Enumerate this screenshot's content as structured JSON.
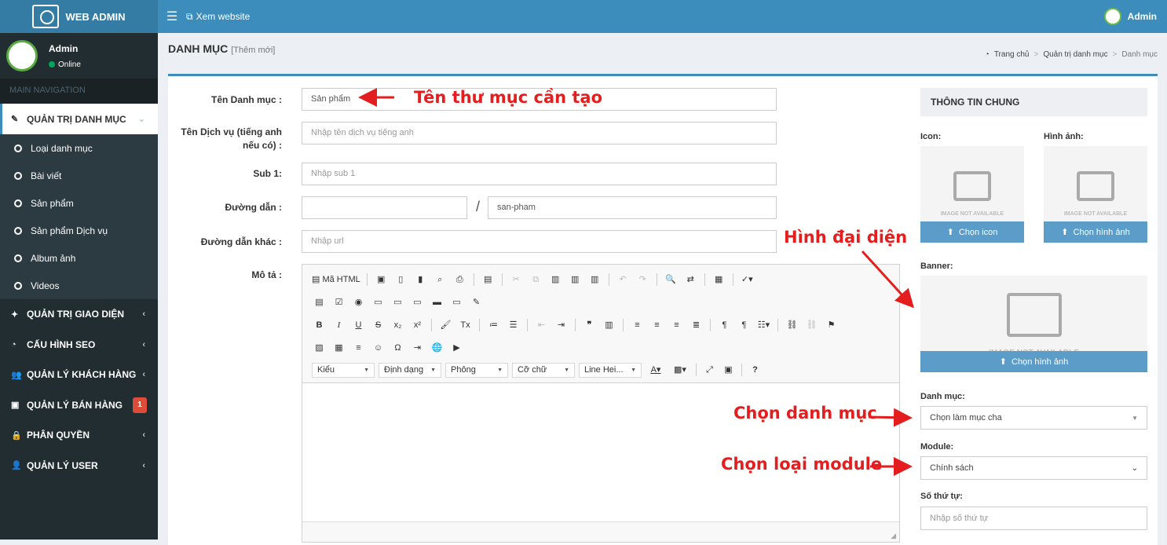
{
  "app": {
    "title": "WEB ADMIN"
  },
  "topbar": {
    "menu_icon": "hamburger-icon",
    "site_label": "Xem website",
    "user": "Admin"
  },
  "user_panel": {
    "name": "Admin",
    "status": "Online"
  },
  "nav": {
    "header": "MAIN NAVIGATION",
    "active": {
      "label": "QUẢN TRỊ DANH MỤC",
      "submenu": [
        "Loại danh mục",
        "Bài viết",
        "Sản phẩm",
        "Sản phẩm Dịch vụ",
        "Album ảnh",
        "Videos"
      ]
    },
    "items": [
      {
        "label": "QUẢN TRỊ GIAO DIỆN",
        "icon": "wand-icon"
      },
      {
        "label": "CẤU HÌNH SEO",
        "icon": "dashboard-icon"
      },
      {
        "label": "QUẢN LÝ KHÁCH HÀNG",
        "icon": "users-icon"
      },
      {
        "label": "QUẢN LÝ BÁN HÀNG",
        "icon": "money-icon",
        "badge": "1"
      },
      {
        "label": "PHÂN QUYỀN",
        "icon": "lock-icon"
      },
      {
        "label": "QUẢN LÝ USER",
        "icon": "user-icon"
      }
    ]
  },
  "page": {
    "title": "DANH MỤC",
    "subtitle": "[Thêm mới]"
  },
  "breadcrumb": [
    "Trang chủ",
    "Quản trị danh mục",
    "Danh mục"
  ],
  "form": {
    "name_label": "Tên Danh mục :",
    "name_value": "Sản phẩm",
    "en_label": "Tên Dịch vụ (tiếng anh nếu có) :",
    "en_placeholder": "Nhập tên dịch vụ tiếng anh",
    "sub_label": "Sub 1:",
    "sub_placeholder": "Nhập sub 1",
    "path_label": "Đường dẫn :",
    "path_prefix": "",
    "path_sep": "/",
    "path_value": "san-pham",
    "other_label": "Đường dẫn khác :",
    "other_placeholder": "Nhập url",
    "desc_label": "Mô tả :"
  },
  "editor": {
    "source_label": "Mã HTML",
    "format_combos": [
      "Kiểu",
      "Định dạng",
      "Phông",
      "Cỡ chữ",
      "Line Hei..."
    ]
  },
  "side": {
    "header": "THÔNG TIN CHUNG",
    "icon_label": "Icon:",
    "image_label": "Hình ảnh:",
    "banner_label": "Banner:",
    "placeholder_text": "IMAGE NOT AVAILABLE",
    "choose_icon": "Chọn icon",
    "choose_image": "Chọn hình ảnh",
    "choose_banner": "Chọn hình ảnh",
    "category_label": "Danh mục:",
    "category_value": "Chọn làm mục cha",
    "module_label": "Module:",
    "module_value": "Chính sách",
    "order_label": "Số thứ tự:",
    "order_placeholder": "Nhập số thứ tự"
  },
  "annotations": {
    "a1": "Tên thư mục cần tạo",
    "a2": "Hình đại diện",
    "a3": "Chọn danh mục",
    "a4": "Chọn loại module"
  },
  "colors": {
    "topbar": "#3c8dbc",
    "sidebar": "#222d32",
    "annotation": "#e41e1e",
    "badge": "#dd4b39"
  }
}
